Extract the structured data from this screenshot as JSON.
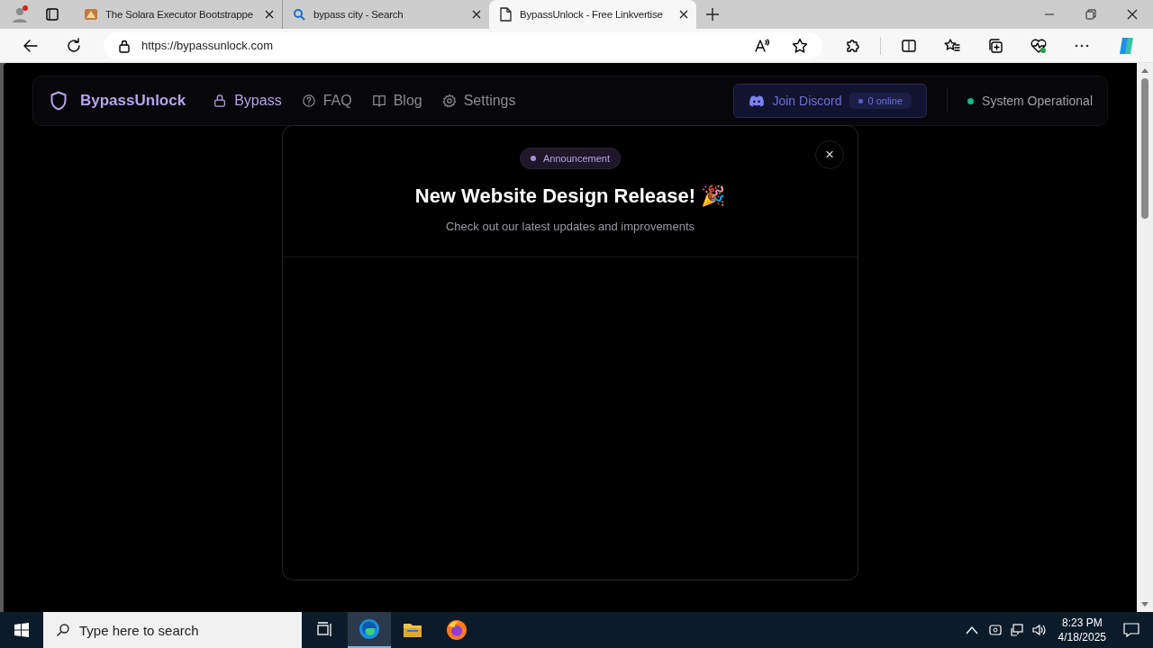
{
  "browser": {
    "tabs": [
      {
        "title": "The Solara Executor Bootstrappe",
        "kind": "app",
        "selected": false
      },
      {
        "title": "bypass city - Search",
        "kind": "search",
        "selected": false
      },
      {
        "title": "BypassUnlock - Free Linkvertise",
        "kind": "page",
        "selected": true
      }
    ],
    "url": "https://bypassunlock.com"
  },
  "site": {
    "brand": "BypassUnlock",
    "nav": [
      {
        "label": "Bypass",
        "kind": "lock",
        "selected": true
      },
      {
        "label": "FAQ",
        "kind": "help",
        "selected": false
      },
      {
        "label": "Blog",
        "kind": "book",
        "selected": false
      },
      {
        "label": "Settings",
        "kind": "gear",
        "selected": false
      }
    ],
    "discord": {
      "label": "Join Discord",
      "count": "0 online"
    },
    "status": {
      "label": "System Operational",
      "color": "#10b981"
    }
  },
  "modal": {
    "badge": "Announcement",
    "title": "New Website Design Release! 🎉",
    "subtitle": "Check out our latest updates and improvements",
    "close": "×"
  },
  "taskbar": {
    "search_placeholder": "Type here to search",
    "time": "8:23 PM",
    "date": "4/18/2025"
  }
}
